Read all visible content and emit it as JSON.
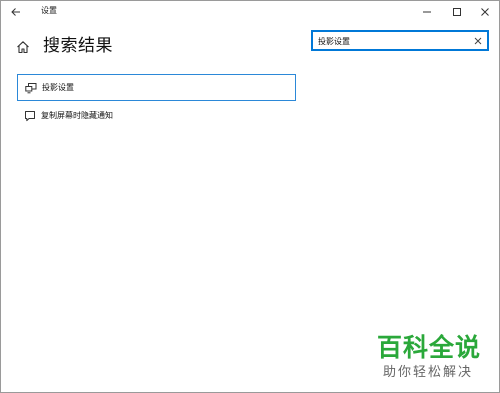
{
  "window": {
    "title": "设置"
  },
  "header": {
    "page_title": "搜索结果"
  },
  "search": {
    "value": "投影设置"
  },
  "results": [
    {
      "label": "投影设置",
      "icon": "projector-icon",
      "selected": true
    },
    {
      "label": "复制屏幕时隐藏通知",
      "icon": "notification-icon",
      "selected": false
    }
  ],
  "watermark": {
    "title": "百科全说",
    "subtitle": "助你轻松解决"
  },
  "colors": {
    "accent": "#0078d7",
    "watermark_green": "#2aa83a"
  }
}
